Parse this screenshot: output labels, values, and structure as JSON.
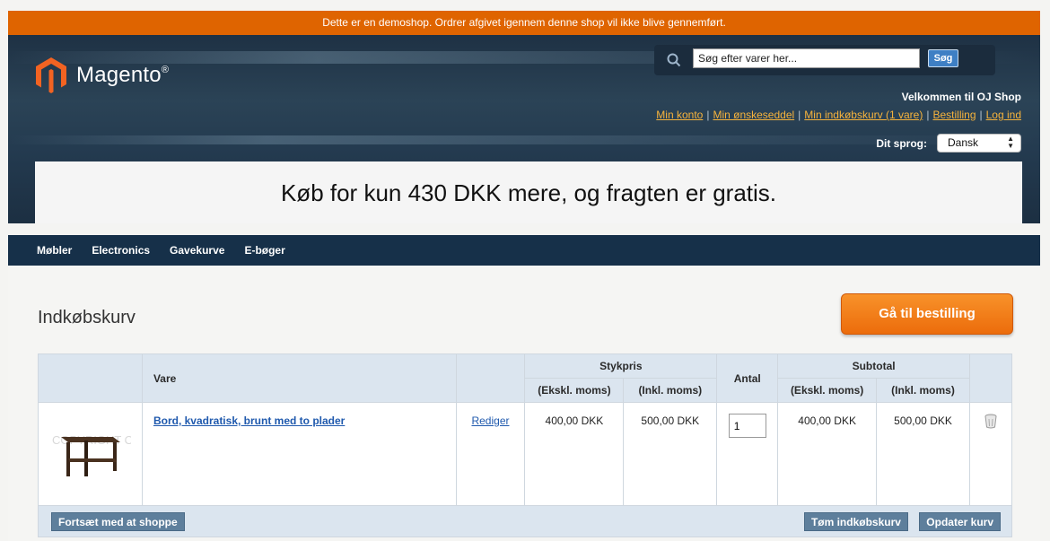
{
  "demo_notice": "Dette er en demoshop. Ordrer afgivet igennem denne shop vil ikke blive gennemført.",
  "brand": {
    "name": "Magento",
    "reg": "®",
    "color": "#f26322"
  },
  "search": {
    "placeholder": "Søg efter varer her...",
    "button": "Søg"
  },
  "welcome": "Velkommen til OJ Shop",
  "top_links": [
    "Min konto",
    "Min ønskeseddel",
    "Min indkøbskurv (1 vare)",
    "Bestilling",
    "Log ind"
  ],
  "language": {
    "label": "Dit sprog:",
    "selected": "Dansk"
  },
  "banner": "Køb for kun 430 DKK mere, og fragten er gratis.",
  "nav": [
    "Møbler",
    "Electronics",
    "Gavekurve",
    "E-bøger"
  ],
  "cart": {
    "title": "Indkøbskurv",
    "checkout_button": "Gå til bestilling",
    "headers": {
      "product": "Vare",
      "unit_price": "Stykpris",
      "qty": "Antal",
      "subtotal": "Subtotal",
      "excl": "(Ekskl. moms)",
      "incl": "(Inkl. moms)"
    },
    "items": [
      {
        "name": "Bord, kvadratisk, brunt med to plader",
        "edit": "Rediger",
        "unit_excl": "400,00 DKK",
        "unit_incl": "500,00 DKK",
        "qty": "1",
        "sub_excl": "400,00 DKK",
        "sub_incl": "500,00 DKK",
        "image_watermark": "COPYRIGHT OJ SHOP"
      }
    ],
    "continue_button": "Fortsæt med at shoppe",
    "empty_button": "Tøm indkøbskurv",
    "update_button": "Opdater kurv"
  },
  "colors": {
    "accent": "#df6400",
    "nav": "#163049",
    "link": "#1f59ad",
    "top_link": "#f7b33c"
  }
}
